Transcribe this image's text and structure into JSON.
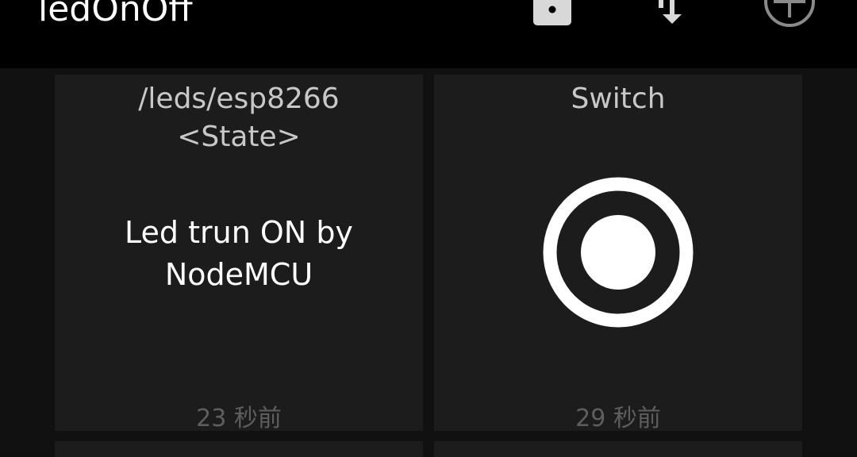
{
  "appbar": {
    "title": "ledOnOff",
    "actions": [
      {
        "name": "lock",
        "icon": "lock-icon"
      },
      {
        "name": "sync",
        "icon": "sync-icon"
      },
      {
        "name": "add",
        "icon": "add-circle-icon"
      }
    ]
  },
  "tiles": [
    {
      "type": "text",
      "title_line1": "/leds/esp8266",
      "title_line2": "<State>",
      "text_line1": "Led trun ON by",
      "text_line2": "NodeMCU",
      "time": "23 秒前"
    },
    {
      "type": "switch",
      "title": "Switch",
      "state": "on",
      "icon": "radio-button-on-icon",
      "time": "29 秒前"
    }
  ],
  "colors": {
    "appbar": "#000000",
    "background": "#111111",
    "tile": "#1c1c1c",
    "title_text": "#c8c8c8",
    "body_text": "#ffffff",
    "time_text": "#5e5e5e",
    "switch": "#ffffff"
  }
}
